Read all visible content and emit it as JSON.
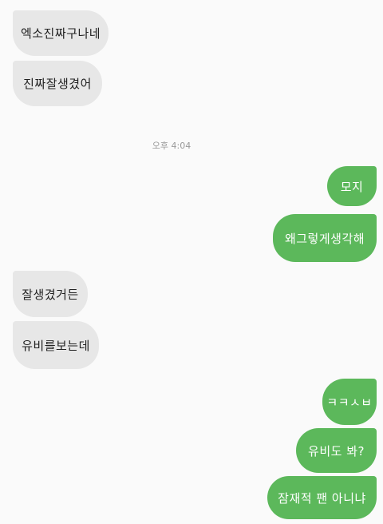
{
  "chat": {
    "timestamp": "오후 4:04",
    "received_1": [
      "엑소진짜구나네",
      "진짜잘생겼어"
    ],
    "sent_1": [
      "모지",
      "왜그렇게생각해"
    ],
    "received_2": [
      "잘생겼거든",
      "유비를보는데"
    ],
    "sent_2": [
      "ㅋㅋㅅㅂ",
      "유비도 봐?",
      "잠재적 팬 아니냐"
    ]
  },
  "colors": {
    "received_bubble": "#e7e7e7",
    "sent_bubble": "#5cb85b",
    "background": "#fafafa"
  }
}
